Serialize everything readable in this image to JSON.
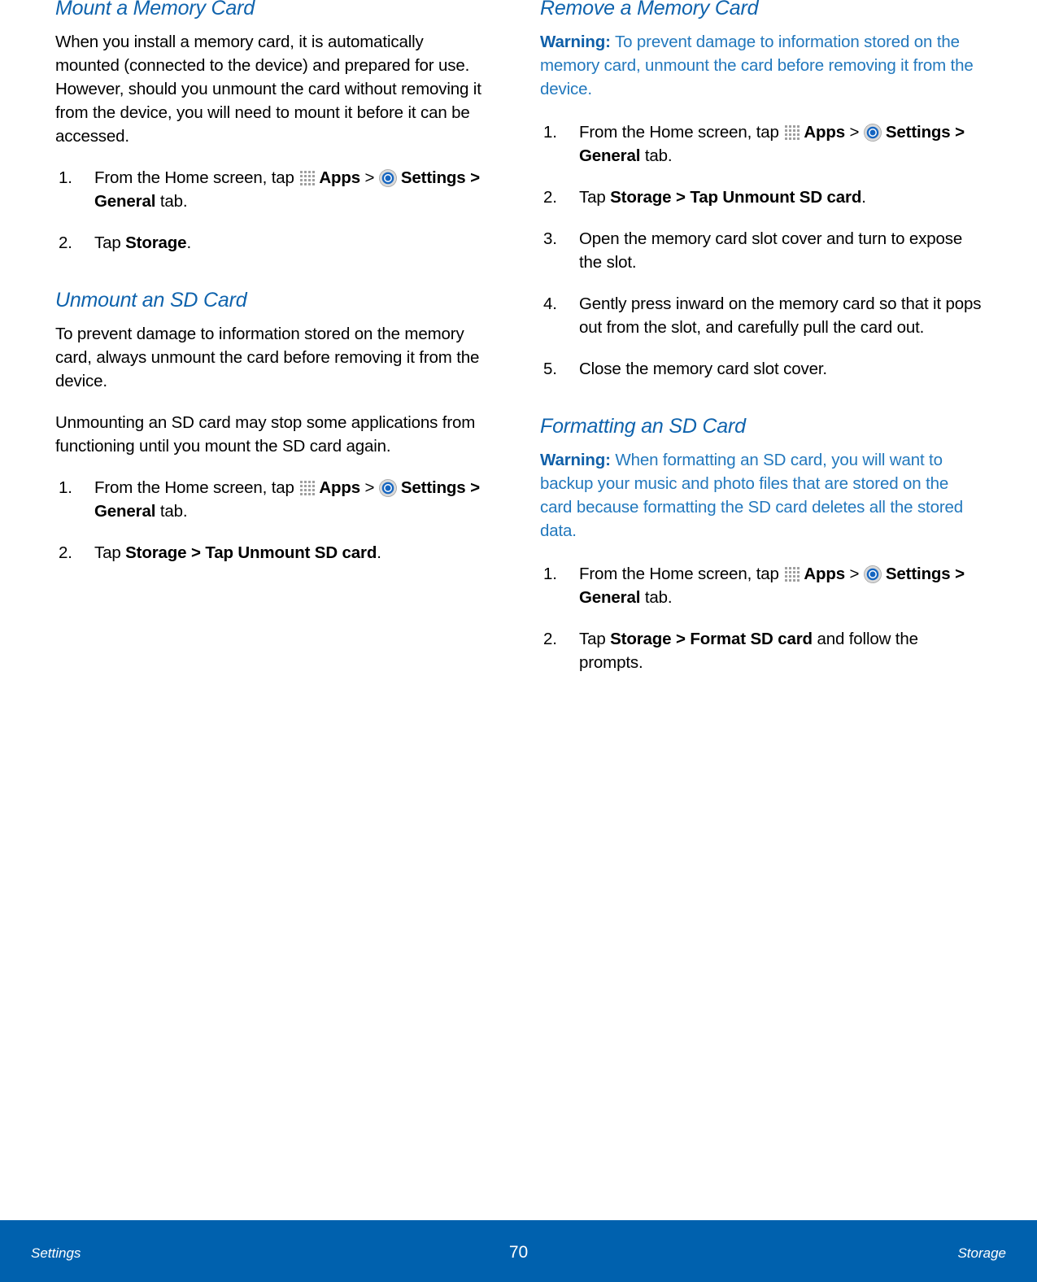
{
  "document": {
    "icons": {
      "apps": "apps-grid-icon",
      "settings": "settings-gear-icon"
    },
    "colors": {
      "heading_blue": "#0f63ad",
      "warning_blue": "#2278bd",
      "warning_label_blue": "#0f5fa8",
      "footer_blue": "#0061ae",
      "apps_icon_gray": "#9d9d9d"
    }
  },
  "left_column": {
    "sections": [
      {
        "id": "mount-a-memory-card",
        "title": "Mount a Memory Card",
        "paragraphs": [
          "When you install a memory card, it is automatically mounted (connected to the device) and prepared for use. However, should you unmount the card without removing it from the device, you will need to mount it before it can be accessed."
        ],
        "steps": [
          {
            "segments": [
              {
                "type": "text",
                "text": "From the Home screen, tap "
              },
              {
                "type": "icon",
                "icon": "apps-grid-icon"
              },
              {
                "type": "bold",
                "text": "Apps"
              },
              {
                "type": "text",
                "text": " > "
              },
              {
                "type": "icon",
                "icon": "settings-gear-icon"
              },
              {
                "type": "bold",
                "text": "Settings > General"
              },
              {
                "type": "text",
                "text": " tab."
              }
            ]
          },
          {
            "segments": [
              {
                "type": "text",
                "text": "Tap "
              },
              {
                "type": "bold",
                "text": "Storage"
              },
              {
                "type": "text",
                "text": "."
              }
            ]
          }
        ]
      },
      {
        "id": "unmount-an-sd-card",
        "title": "Unmount an SD Card",
        "paragraphs": [
          "To prevent damage to information stored on the memory card, always unmount the card before removing it from the device.",
          "Unmounting an SD card may stop some applications from functioning until you mount the SD card again."
        ],
        "steps": [
          {
            "segments": [
              {
                "type": "text",
                "text": "From the Home screen, tap "
              },
              {
                "type": "icon",
                "icon": "apps-grid-icon"
              },
              {
                "type": "bold",
                "text": "Apps"
              },
              {
                "type": "text",
                "text": " > "
              },
              {
                "type": "icon",
                "icon": "settings-gear-icon"
              },
              {
                "type": "bold",
                "text": "Settings > General"
              },
              {
                "type": "text",
                "text": " tab."
              }
            ]
          },
          {
            "segments": [
              {
                "type": "text",
                "text": "Tap "
              },
              {
                "type": "bold",
                "text": "Storage > Tap Unmount SD card"
              },
              {
                "type": "text",
                "text": "."
              }
            ]
          }
        ]
      }
    ]
  },
  "right_column": {
    "sections": [
      {
        "id": "remove-a-memory-card",
        "title": "Remove a Memory Card",
        "warning": {
          "label": "Warning:",
          "text": " To prevent damage to information stored on the memory card, unmount the card before removing it from the device."
        },
        "steps": [
          {
            "segments": [
              {
                "type": "text",
                "text": "From the Home screen, tap "
              },
              {
                "type": "icon",
                "icon": "apps-grid-icon"
              },
              {
                "type": "bold",
                "text": "Apps"
              },
              {
                "type": "text",
                "text": " > "
              },
              {
                "type": "icon",
                "icon": "settings-gear-icon"
              },
              {
                "type": "bold",
                "text": "Settings > General"
              },
              {
                "type": "text",
                "text": " tab."
              }
            ]
          },
          {
            "segments": [
              {
                "type": "text",
                "text": "Tap "
              },
              {
                "type": "bold",
                "text": "Storage > Tap Unmount SD card"
              },
              {
                "type": "text",
                "text": "."
              }
            ]
          },
          {
            "segments": [
              {
                "type": "text",
                "text": "Open the memory card slot cover and turn to expose the slot."
              }
            ]
          },
          {
            "segments": [
              {
                "type": "text",
                "text": "Gently press inward on the memory card so that it pops out from the slot, and carefully pull the card out."
              }
            ]
          },
          {
            "segments": [
              {
                "type": "text",
                "text": "Close the memory card slot cover."
              }
            ]
          }
        ]
      },
      {
        "id": "formatting-an-sd-card",
        "title": "Formatting an SD Card",
        "warning": {
          "label": "Warning:",
          "text": " When formatting an SD card, you will want to backup your music and photo files that are stored on the card because formatting the SD card deletes all the stored data."
        },
        "steps": [
          {
            "segments": [
              {
                "type": "text",
                "text": "From the Home screen, tap "
              },
              {
                "type": "icon",
                "icon": "apps-grid-icon"
              },
              {
                "type": "bold",
                "text": "Apps"
              },
              {
                "type": "text",
                "text": " > "
              },
              {
                "type": "icon",
                "icon": "settings-gear-icon"
              },
              {
                "type": "bold",
                "text": "Settings > General"
              },
              {
                "type": "text",
                "text": " tab."
              }
            ]
          },
          {
            "segments": [
              {
                "type": "text",
                "text": "Tap "
              },
              {
                "type": "bold",
                "text": "Storage > Format SD card"
              },
              {
                "type": "text",
                "text": " and follow the prompts."
              }
            ]
          }
        ]
      }
    ]
  },
  "footer": {
    "left_label": "Settings",
    "page_number": "70",
    "right_label": "Storage"
  }
}
